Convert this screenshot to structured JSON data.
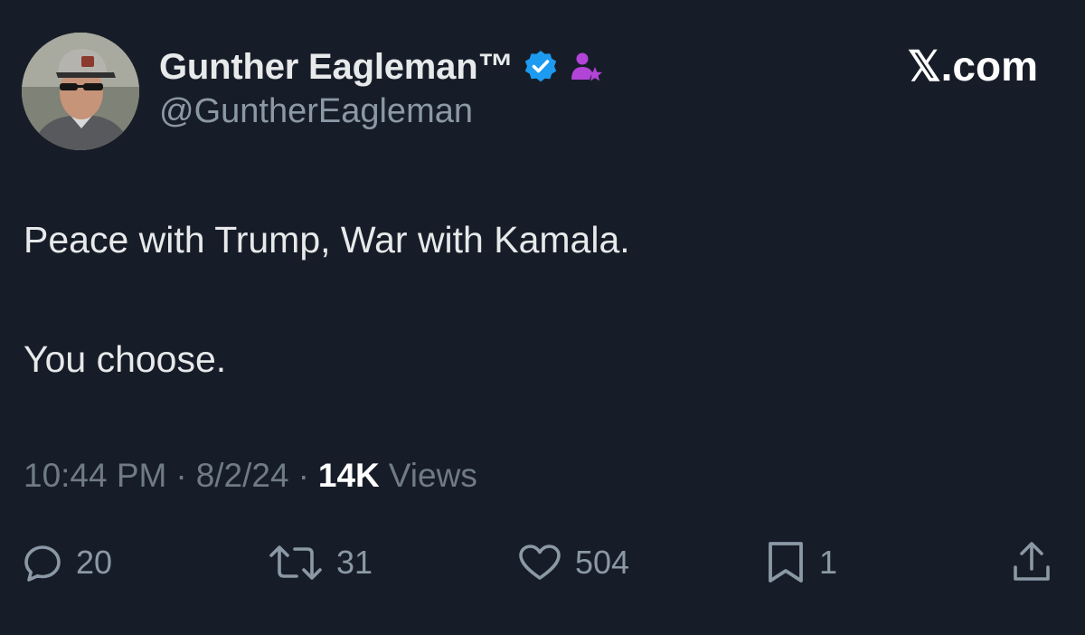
{
  "author": {
    "display_name": "Gunther Eagleman™",
    "handle": "@GuntherEagleman"
  },
  "source": "𝕏.com",
  "tweet": {
    "line1": "Peace with Trump, War with Kamala.",
    "line2": "You choose."
  },
  "meta": {
    "time": "10:44 PM",
    "date": "8/2/24",
    "separator": "·",
    "views_count": "14K",
    "views_label": "Views"
  },
  "actions": {
    "replies": "20",
    "reposts": "31",
    "likes": "504",
    "bookmarks": "1"
  },
  "colors": {
    "background": "#171d28",
    "verified": "#1d9bf0",
    "affiliate": "#b244d7"
  },
  "icons": [
    "verified-badge-icon",
    "affiliate-badge-icon",
    "reply-icon",
    "repost-icon",
    "like-icon",
    "bookmark-icon",
    "share-icon"
  ]
}
